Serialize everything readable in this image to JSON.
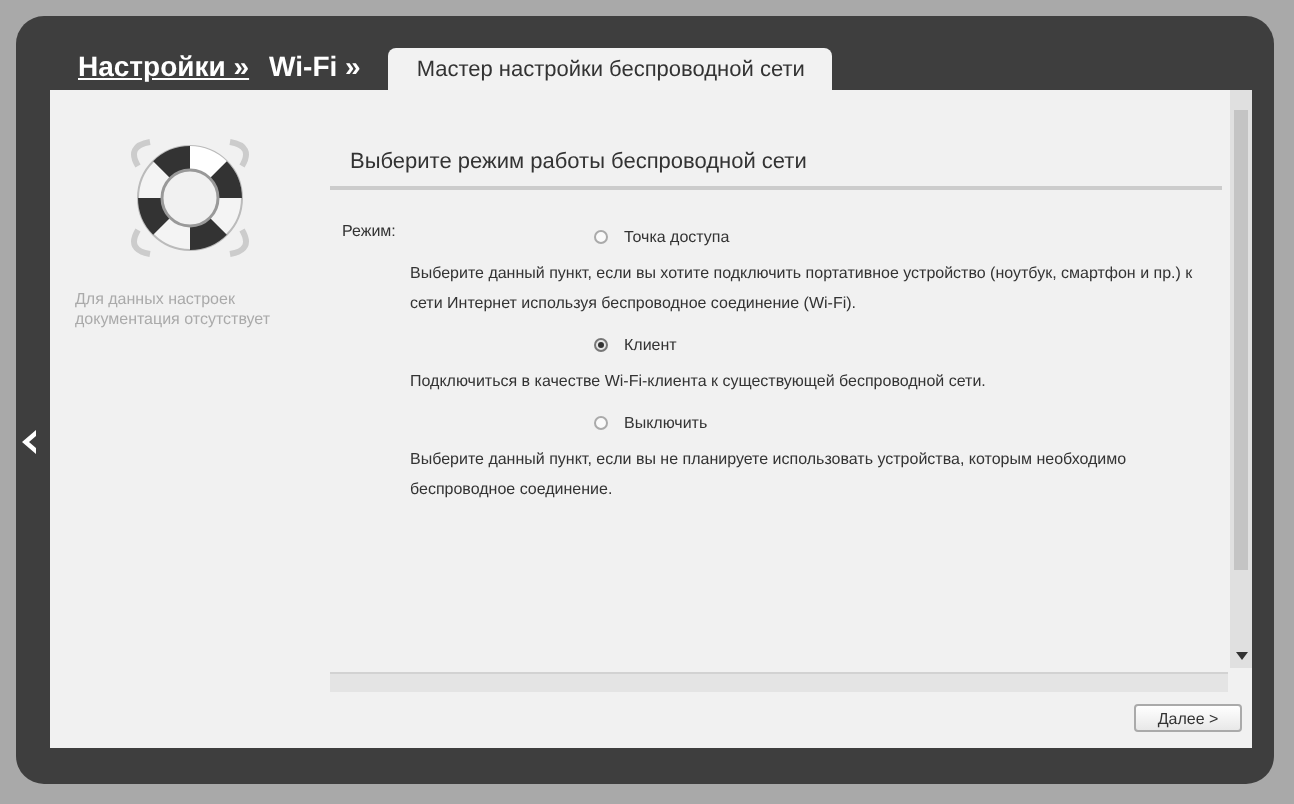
{
  "breadcrumbs": [
    {
      "label": "Настройки »",
      "link": true
    },
    {
      "label": "Wi-Fi »",
      "link": false
    }
  ],
  "tab": {
    "label": "Мастер настройки беспроводной сети",
    "selected": true
  },
  "sidebar": {
    "note": "Для данных настроек документация отсутствует"
  },
  "section_title": "Выберите режим работы беспроводной сети",
  "mode_label": "Режим:",
  "options": [
    {
      "label": "Точка доступа",
      "selected": false,
      "description": "Выберите данный пункт, если вы хотите подключить портативное устройство (ноутбук, смартфон и пр.) к сети Интернет используя беспроводное соединение (Wi-Fi)."
    },
    {
      "label": "Клиент",
      "selected": true,
      "description": "Подключиться в качестве Wi-Fi-клиента к существующей беспроводной сети."
    },
    {
      "label": "Выключить",
      "selected": false,
      "description": "Выберите данный пункт, если вы не планируете использовать устройства, которым необходимо беспроводное соединение."
    }
  ],
  "next_button": "Далее >"
}
